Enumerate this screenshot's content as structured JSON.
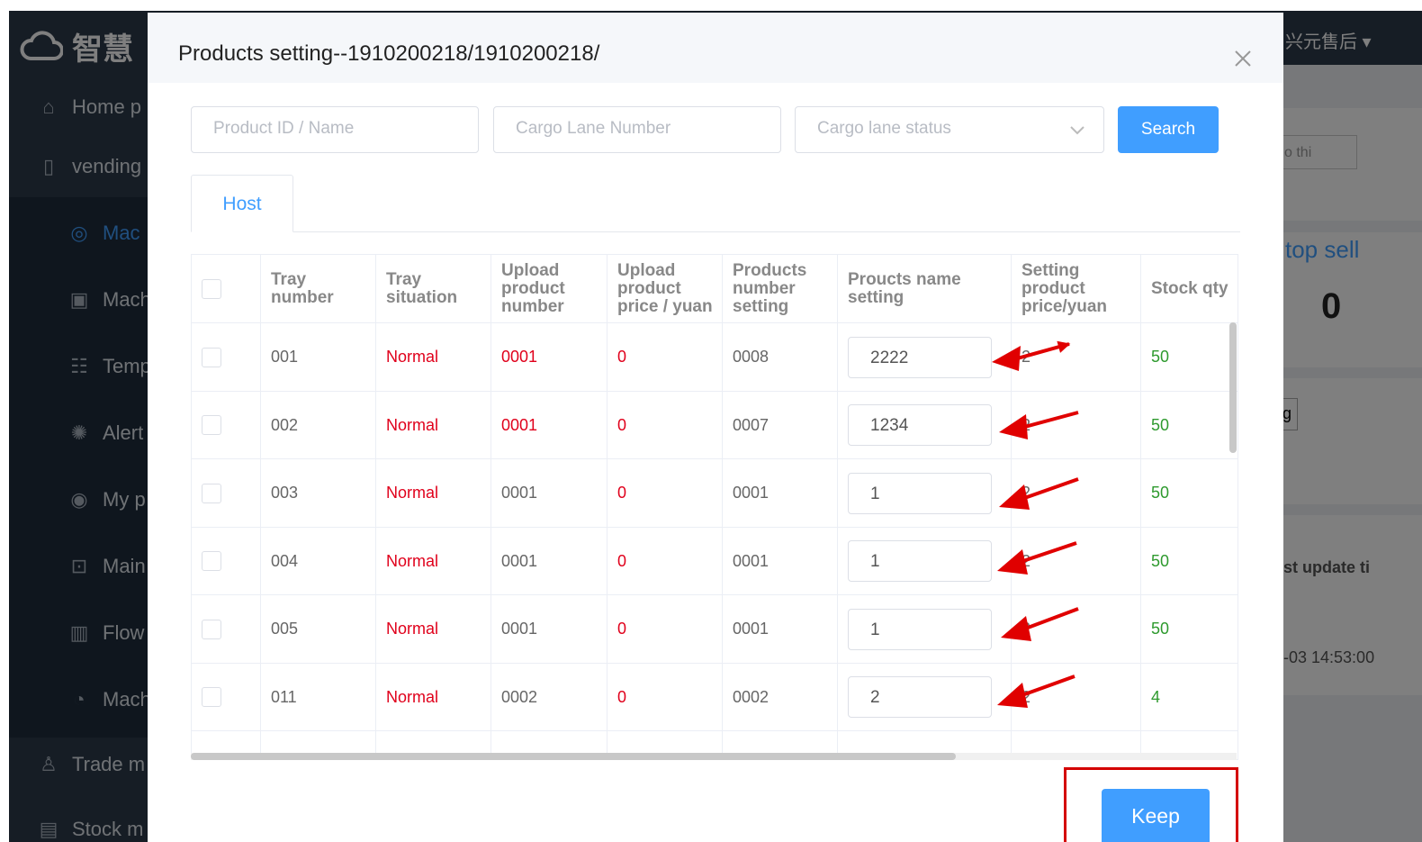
{
  "sidebar": {
    "logo_text": "智慧",
    "items": [
      {
        "label": "Home p",
        "icon": "home-icon"
      },
      {
        "label": "vending",
        "icon": "vending-icon"
      },
      {
        "label": "Mac",
        "icon": "monitor-icon"
      },
      {
        "label": "Mach",
        "icon": "lock-icon"
      },
      {
        "label": "Temp",
        "icon": "template-icon"
      },
      {
        "label": "Alert",
        "icon": "alarm-icon"
      },
      {
        "label": "My p",
        "icon": "location-icon"
      },
      {
        "label": "Main",
        "icon": "maintenance-icon"
      },
      {
        "label": "Flow",
        "icon": "flow-icon"
      },
      {
        "label": "Mach",
        "icon": "machine-icon"
      },
      {
        "label": "Trade m",
        "icon": "trade-icon"
      },
      {
        "label": "Stock m",
        "icon": "stock-icon"
      }
    ]
  },
  "header": {
    "user": "兴元售后 ▾"
  },
  "background": {
    "select_text": "o thi",
    "card_title": "top sell",
    "card_value": "0",
    "button_text": "g",
    "table_header": "st update ti",
    "table_cell": "-03 14:53:00"
  },
  "modal": {
    "title": "Products setting--1910200218/1910200218/",
    "filters": {
      "product_placeholder": "Product ID / Name",
      "lane_placeholder": "Cargo Lane Number",
      "status_placeholder": "Cargo lane status",
      "search_label": "Search"
    },
    "tab": "Host",
    "columns": [
      "",
      "Tray number",
      "Tray situation",
      "Upload product number",
      "Upload product price / yuan",
      "Products number setting",
      "Proucts name setting",
      "Setting product price/yuan",
      "Stock qty"
    ],
    "rows": [
      {
        "tray": "001",
        "situation": "Normal",
        "upload_num": "0001",
        "upload_num_red": true,
        "price": "0",
        "num_setting": "0008",
        "name": "2222",
        "set_price": "2",
        "stock": "50"
      },
      {
        "tray": "002",
        "situation": "Normal",
        "upload_num": "0001",
        "upload_num_red": true,
        "price": "0",
        "num_setting": "0007",
        "name": "1234",
        "set_price": "2",
        "stock": "50"
      },
      {
        "tray": "003",
        "situation": "Normal",
        "upload_num": "0001",
        "upload_num_red": false,
        "price": "0",
        "num_setting": "0001",
        "name": "1",
        "set_price": "2",
        "stock": "50"
      },
      {
        "tray": "004",
        "situation": "Normal",
        "upload_num": "0001",
        "upload_num_red": false,
        "price": "0",
        "num_setting": "0001",
        "name": "1",
        "set_price": "2",
        "stock": "50"
      },
      {
        "tray": "005",
        "situation": "Normal",
        "upload_num": "0001",
        "upload_num_red": false,
        "price": "0",
        "num_setting": "0001",
        "name": "1",
        "set_price": "2",
        "stock": "50"
      },
      {
        "tray": "011",
        "situation": "Normal",
        "upload_num": "0002",
        "upload_num_red": false,
        "price": "0",
        "num_setting": "0002",
        "name": "2",
        "set_price": "2",
        "stock": "4"
      }
    ],
    "keep_label": "Keep"
  },
  "colors": {
    "primary": "#409eff",
    "sidebar": "#2d3a4b",
    "status_red": "#e0001b",
    "stock_green": "#2e9a2e",
    "annotation_red": "#e00000"
  }
}
